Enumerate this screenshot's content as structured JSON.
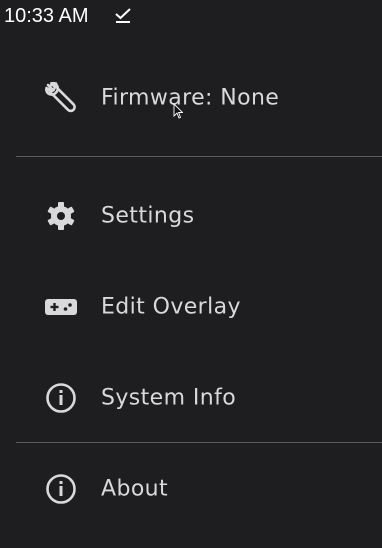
{
  "status_bar": {
    "time": "10:33 AM",
    "icon": "download-done-icon"
  },
  "menu": {
    "items": [
      {
        "label": "Firmware: None",
        "icon": "wrench-icon"
      },
      {
        "label": "Settings",
        "icon": "gear-icon"
      },
      {
        "label": "Edit Overlay",
        "icon": "gamepad-icon"
      },
      {
        "label": "System Info",
        "icon": "info-icon"
      },
      {
        "label": "About",
        "icon": "info-icon"
      }
    ]
  },
  "colors": {
    "background": "#1e1e21",
    "text": "#d9d9db",
    "divider": "#5a5a5e"
  }
}
